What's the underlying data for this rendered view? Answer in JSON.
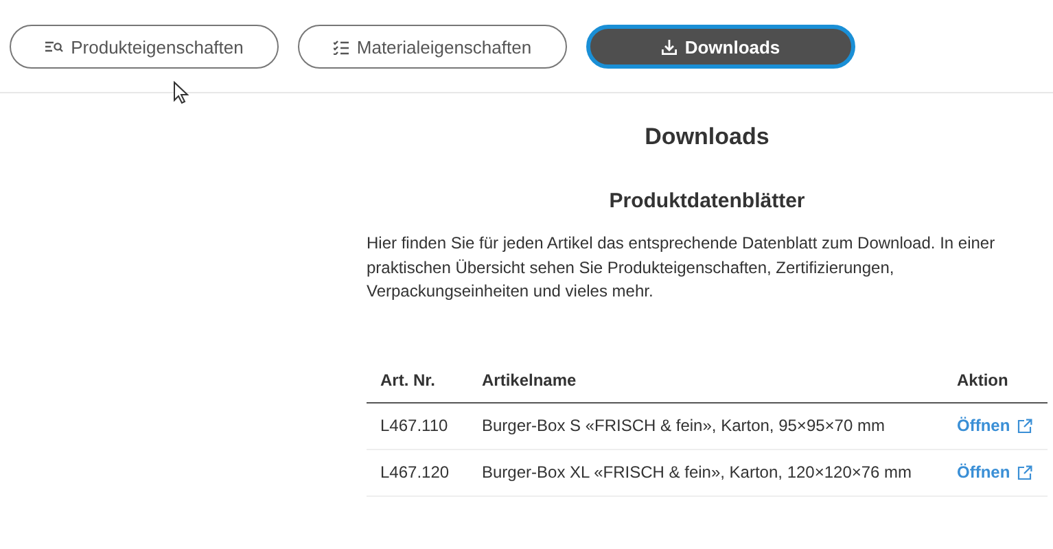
{
  "tabs": [
    {
      "label": "Produkteigenschaften",
      "kind": "list-search",
      "selected": false
    },
    {
      "label": "Materialeigenschaften",
      "kind": "checklist",
      "selected": false
    },
    {
      "label": "Downloads",
      "kind": "download",
      "selected": true
    }
  ],
  "section": {
    "title": "Downloads",
    "subtitle": "Produktdatenblätter",
    "text": "Hier finden Sie für jeden Artikel das entsprechende Datenblatt zum Download. In einer praktischen Übersicht sehen Sie Produkteigenschaften, Zertifizierungen, Verpackungseinheiten und vieles mehr."
  },
  "table": {
    "columns": [
      "Art. Nr.",
      "Artikelname",
      "Aktion"
    ],
    "rows": [
      {
        "number": "L467.110",
        "name": "Burger-Box S «FRISCH & fein», Karton, 95×95×70 mm",
        "action": "Öffnen"
      },
      {
        "number": "L467.120",
        "name": "Burger-Box XL «FRISCH & fein», Karton, 120×120×76 mm",
        "action": "Öffnen"
      }
    ]
  }
}
